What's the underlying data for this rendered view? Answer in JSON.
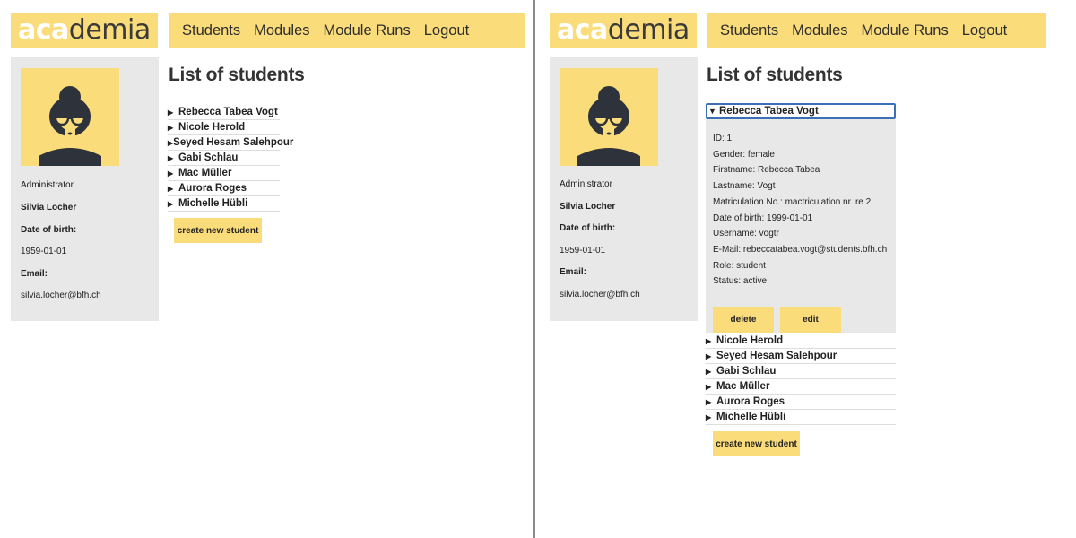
{
  "app": {
    "logo_aca": "aca",
    "logo_demia": "demia",
    "colors": {
      "accent": "#fbdc7a",
      "sidebar": "#e8e8e8",
      "focus": "#3d6fb6"
    }
  },
  "nav": {
    "items": [
      "Students",
      "Modules",
      "Module Runs",
      "Logout"
    ]
  },
  "sidebar": {
    "role": "Administrator",
    "name": "Silvia Locher",
    "dob_label": "Date of birth:",
    "dob": "1959-01-01",
    "email_label": "Email:",
    "email": "silvia.locher@bfh.ch"
  },
  "page": {
    "title": "List of students",
    "create_label": "create new student"
  },
  "students": [
    "Rebecca Tabea Vogt",
    "Nicole Herold",
    "Seyed Hesam Salehpour",
    "Gabi Schlau",
    "Mac Müller",
    "Aurora Roges",
    "Michelle Hübli"
  ],
  "expanded": {
    "name": "Rebecca Tabea Vogt",
    "details": [
      "ID: 1",
      "Gender: female",
      "Firstname: Rebecca Tabea",
      "Lastname: Vogt",
      "Matriculation No.: mactriculation nr. re 2",
      "Date of birth: 1999-01-01",
      "Username: vogtr",
      "E-Mail: rebeccatabea.vogt@students.bfh.ch",
      "Role: student",
      "Status: active"
    ],
    "delete_label": "delete",
    "edit_label": "edit"
  },
  "icons": {
    "collapsed": "▶",
    "expanded": "▼"
  }
}
